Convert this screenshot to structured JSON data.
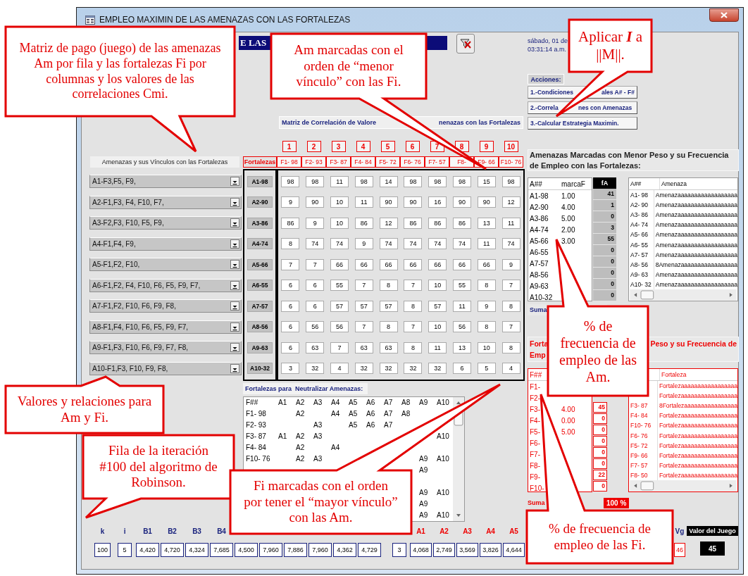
{
  "window": {
    "title": "EMPLEO MAXIMIN DE LAS AMENAZAS CON LAS FORTALEZAS"
  },
  "banner": {
    "text": "E LAS"
  },
  "date": "sábado, 01 de",
  "time": "03:31:14 a.m.",
  "actions": {
    "label": "Acciones:",
    "buttons": [
      {
        "parts": [
          "1.-Condiciones",
          "ales A# - F#"
        ]
      },
      {
        "parts": [
          "2.-Correla",
          "nes con Amenazas"
        ]
      },
      {
        "parts": [
          "3.-Calcular Estrategia Maximin."
        ]
      }
    ]
  },
  "links": {
    "label": "Amenazas y sus Vínculos con las Fortalezas",
    "items": [
      "A1-F3,F5, F9,",
      "A2-F1,F3, F4, F10, F7,",
      "A3-F2,F3, F10, F5, F9,",
      "A4-F1,F4, F9,",
      "A5-F1,F2, F10,",
      "A6-F1,F2, F4, F10, F6, F5, F9, F7,",
      "A7-F1,F2, F10, F6, F9, F8,",
      "A8-F1,F4, F10, F6, F5, F9, F7,",
      "A9-F1,F3, F10, F6, F9, F7, F8,",
      "A10-F1,F3, F10, F9, F8,"
    ]
  },
  "matrix": {
    "heading_parts": [
      "Matriz de Correlación de Valore",
      "nenazas con las Fortalezas"
    ],
    "corner": "Fortalezas",
    "column_numbers": [
      "1",
      "2",
      "3",
      "4",
      "5",
      "6",
      "7",
      "8",
      "9",
      "10"
    ],
    "columns": [
      "F1- 98",
      "F2- 93",
      "F3- 87",
      "F4- 84",
      "F5- 72",
      "F6- 76",
      "F7- 57",
      "F8-",
      "F9- 66",
      "F10- 76"
    ],
    "rows": [
      {
        "label": "A1-98",
        "values": [
          "98",
          "98",
          "11",
          "98",
          "14",
          "98",
          "98",
          "98",
          "15",
          "98"
        ]
      },
      {
        "label": "A2-90",
        "values": [
          "9",
          "90",
          "10",
          "11",
          "90",
          "90",
          "16",
          "90",
          "90",
          "12"
        ]
      },
      {
        "label": "A3-86",
        "values": [
          "86",
          "9",
          "10",
          "86",
          "12",
          "86",
          "86",
          "86",
          "13",
          "11"
        ]
      },
      {
        "label": "A4-74",
        "values": [
          "8",
          "74",
          "74",
          "9",
          "74",
          "74",
          "74",
          "74",
          "11",
          "74"
        ]
      },
      {
        "label": "A5-66",
        "values": [
          "7",
          "7",
          "66",
          "66",
          "66",
          "66",
          "66",
          "66",
          "66",
          "9"
        ]
      },
      {
        "label": "A6-55",
        "values": [
          "6",
          "6",
          "55",
          "7",
          "8",
          "7",
          "10",
          "55",
          "8",
          "7"
        ]
      },
      {
        "label": "A7-57",
        "values": [
          "6",
          "6",
          "57",
          "57",
          "57",
          "8",
          "57",
          "11",
          "9",
          "8"
        ]
      },
      {
        "label": "A8-56",
        "values": [
          "6",
          "56",
          "56",
          "7",
          "8",
          "7",
          "10",
          "56",
          "8",
          "7"
        ]
      },
      {
        "label": "A9-63",
        "values": [
          "6",
          "63",
          "7",
          "63",
          "63",
          "8",
          "11",
          "13",
          "10",
          "8"
        ]
      },
      {
        "label": "A10-32",
        "values": [
          "3",
          "32",
          "4",
          "32",
          "32",
          "32",
          "32",
          "6",
          "5",
          "4"
        ]
      }
    ]
  },
  "neutralize": {
    "title": "Fortalezas para  Neutralizar Amenazas:",
    "columns": [
      "F##",
      "A1",
      "A2",
      "A3",
      "A4",
      "A5",
      "A6",
      "A7",
      "A8",
      "A9",
      "A10"
    ],
    "rows": [
      {
        "cells": [
          "F1- 98",
          "",
          "A2",
          "",
          "A4",
          "A5",
          "A6",
          "A7",
          "A8",
          "",
          ""
        ]
      },
      {
        "cells": [
          "F2- 93",
          "",
          "",
          "A3",
          "",
          "A5",
          "A6",
          "A7",
          "",
          "",
          ""
        ]
      },
      {
        "cells": [
          "F3- 87",
          "A1",
          "A2",
          "A3",
          "",
          "",
          "",
          "",
          "",
          "",
          "A10"
        ]
      },
      {
        "cells": [
          "F4- 84",
          "",
          "A2",
          "",
          "A4",
          "",
          "",
          "",
          "",
          "",
          ""
        ]
      },
      {
        "cells": [
          "F10- 76",
          "",
          "A2",
          "A3",
          "",
          "",
          "",
          "",
          "",
          "A9",
          "A10"
        ]
      },
      {
        "cells": [
          "",
          "",
          "",
          "",
          "",
          "",
          "",
          "",
          "",
          "A9",
          ""
        ]
      },
      {
        "cells": [
          "",
          "",
          "",
          "",
          "",
          "",
          "",
          "",
          "",
          "",
          ""
        ]
      },
      {
        "cells": [
          "",
          "",
          "",
          "",
          "",
          "",
          "",
          "",
          "",
          "A9",
          "A10"
        ]
      },
      {
        "cells": [
          "",
          "",
          "",
          "",
          "",
          "",
          "",
          "",
          "",
          "A9",
          ""
        ]
      },
      {
        "cells": [
          "",
          "",
          "",
          "",
          "",
          "",
          "",
          "",
          "",
          "A9",
          "A10"
        ]
      }
    ]
  },
  "threats": {
    "title": "Amenazas Marcadas con Menor Peso y su Frecuencia de Empleo con las Fortalezas:",
    "columns": [
      "A##",
      "marcaF",
      "fA"
    ],
    "rows": [
      {
        "code": "A1-98",
        "mark": "1.00",
        "freq": "41"
      },
      {
        "code": "A2-90",
        "mark": "4.00",
        "freq": "1"
      },
      {
        "code": "A3-86",
        "mark": "5.00",
        "freq": "0"
      },
      {
        "code": "A4-74",
        "mark": "2.00",
        "freq": "3"
      },
      {
        "code": "A5-66",
        "mark": "3.00",
        "freq": "55"
      },
      {
        "code": "A6-55",
        "freq": "0"
      },
      {
        "code": "A7-57",
        "freq": "0"
      },
      {
        "code": "A8-56",
        "freq": "0"
      },
      {
        "code": "A9-63",
        "freq": "0"
      },
      {
        "code": "A10-32",
        "freq": "0"
      }
    ],
    "sum_label": "Suma"
  },
  "threat_names": {
    "columns": [
      "A##",
      "Amenaza"
    ],
    "rows": [
      {
        "code": "A1- 98",
        "name": "Amenazaaaaaaaaaaaaaaaaaa"
      },
      {
        "code": "A2- 90",
        "name": "Amenazaaaaaaaaaaaaaaaaaa"
      },
      {
        "code": "A3- 86",
        "name": "Amenazaaaaaaaaaaaaaaaaaa"
      },
      {
        "code": "A4- 74",
        "name": "Amenazaaaaaaaaaaaaaaaaaa"
      },
      {
        "code": "A5- 66",
        "name": "Amenazaaaaaaaaaaaaaaaaaa"
      },
      {
        "code": "A6- 55",
        "name": "Amenazaaaaaaaaaaaaaaaaaa"
      },
      {
        "code": "A7- 57",
        "name": "Amenazaaaaaaaaaaaaaaaaaa"
      },
      {
        "code": "A8- 56",
        "name": "8Amenazaaaaaaaaaaaaaaaaa"
      },
      {
        "code": "A9- 63",
        "name": "Amenazaaaaaaaaaaaaaaaaaa"
      },
      {
        "code": "A10- 32",
        "name": "Amenazaaaaaaaaaaaaaaaaaa"
      }
    ]
  },
  "strengths": {
    "title_parts": [
      "Forta",
      "Emp",
      "Peso y su Frecuencia de"
    ],
    "columns": [
      "F##"
    ],
    "rows": [
      {
        "code": "F1-"
      },
      {
        "code": "F2-"
      },
      {
        "code": "F3-",
        "mark": "4.00",
        "freq": "45"
      },
      {
        "code": "F4-",
        "mark": "0.00",
        "freq": "0"
      },
      {
        "code": "F5-",
        "mark": "5.00",
        "freq": "0"
      },
      {
        "code": "F6-",
        "freq": "0"
      },
      {
        "code": "F7-",
        "freq": "0"
      },
      {
        "code": "F8-",
        "freq": "0"
      },
      {
        "code": "F9-",
        "freq": "22"
      },
      {
        "code": "F10-",
        "freq": "0"
      }
    ],
    "sum_label": "Suma",
    "sum_value": "100 %"
  },
  "strength_names": {
    "columns": [
      "Fortaleza"
    ],
    "rows": [
      {
        "name": "Fortalezaaaaaaaaaaaaaaaaa"
      },
      {
        "name": "Fortalezaaaaaaaaaaaaaaaaa"
      },
      {
        "code": "F3- 87",
        "name": "8Fortalezaaaaaaaaaaaaaaaa"
      },
      {
        "code": "F4- 84",
        "name": "Fortalezaaaaaaaaaaaaaaaaa"
      },
      {
        "code": "F10- 76",
        "name": "Fortalezaaaaaaaaaaaaaaaaa"
      },
      {
        "code": "F6- 76",
        "name": "Fortalezaaaaaaaaaaaaaaaaa"
      },
      {
        "code": "F5- 72",
        "name": "Fortalezaaaaaaaaaaaaaaaaa"
      },
      {
        "code": "F9- 66",
        "name": "Fortalezaaaaaaaaaaaaaaaaa"
      },
      {
        "code": "F7- 57",
        "name": "Fortalezaaaaaaaaaaaaaaaaa"
      },
      {
        "code": "F8- 50",
        "name": "Fortalezaaaaaaaaaaaaaaaaa"
      }
    ]
  },
  "iteration": {
    "cells": [
      {
        "kind": "index",
        "label": "k",
        "value": "100"
      },
      {
        "kind": "index",
        "label": "i",
        "value": "5"
      },
      {
        "kind": "b",
        "label": "B1",
        "value": "4,420"
      },
      {
        "kind": "b",
        "label": "B2",
        "value": "4,720"
      },
      {
        "kind": "b",
        "label": "B3",
        "value": "4,324"
      },
      {
        "kind": "b",
        "label": "B4",
        "value": "7,685"
      },
      {
        "kind": "b",
        "value": "4,500"
      },
      {
        "kind": "b",
        "value": "7,960"
      },
      {
        "kind": "b",
        "value": "7,886"
      },
      {
        "kind": "b",
        "value": "7,960"
      },
      {
        "kind": "b",
        "value": "4,362"
      },
      {
        "kind": "b",
        "value": "4,729"
      },
      {
        "kind": "index",
        "value": "3"
      },
      {
        "kind": "a",
        "label": "A1",
        "value": "4,068"
      },
      {
        "kind": "a",
        "label": "A2",
        "value": "2,749"
      },
      {
        "kind": "a",
        "label": "A3",
        "value": "3,569"
      },
      {
        "kind": "a",
        "label": "A4",
        "value": "3,826"
      },
      {
        "kind": "a",
        "label": "A5",
        "value": "4,644"
      },
      {
        "kind": "average",
        "label": "Vg",
        "value": "46"
      }
    ]
  },
  "game_value": {
    "label": "Valor del Juego",
    "value": "45"
  },
  "callouts": [
    {
      "text": "Matriz de pago (juego) de las amenazas Am por fila y las fortalezas Fi por columnas y los valores de las correlaciones Cmi."
    },
    {
      "text": "Am marcadas con el orden de “menor vínculo” con las Fi."
    },
    {
      "text": "Aplicar *I* a ||M||."
    },
    {
      "text": "% de frecuencia de empleo de las Am."
    },
    {
      "text": "% de frecuencia de empleo de las Fi."
    },
    {
      "text": "Valores y relaciones para Am y Fi."
    },
    {
      "text": "Fila de la iteración #100 del algoritmo de Robinson."
    },
    {
      "text": "Fi marcadas con el orden por tener el “mayor vínculo” con las Am."
    }
  ]
}
